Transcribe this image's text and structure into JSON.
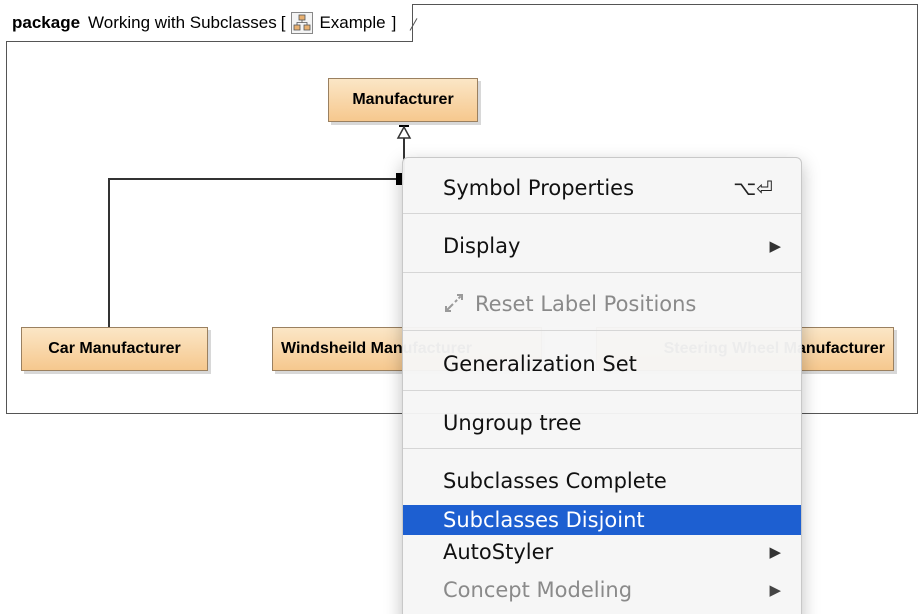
{
  "diagram": {
    "frame_keyword": "package",
    "frame_title": "Working with Subclasses",
    "frame_bracket_open": "[",
    "frame_diagram_name": "Example",
    "frame_bracket_close": "]",
    "classes": {
      "manufacturer": "Manufacturer",
      "car": "Car Manufacturer",
      "windshield": "Windsheild Manufacturer",
      "steering": "Steering Wheel Manufacturer"
    }
  },
  "context_menu": {
    "items": [
      {
        "label": "Symbol Properties",
        "shortcut": "⌥⏎",
        "enabled": true
      },
      {
        "label": "Display",
        "submenu": true,
        "enabled": true
      },
      {
        "label": "Reset Label Positions",
        "enabled": false,
        "icon": "reset-labels-icon"
      },
      {
        "label": "Generalization Set",
        "enabled": true
      },
      {
        "label": "Ungroup tree",
        "enabled": true
      },
      {
        "label": "Subclasses Complete",
        "enabled": true
      },
      {
        "label": "Subclasses Disjoint",
        "enabled": true,
        "selected": true
      },
      {
        "label": "AutoStyler",
        "submenu": true,
        "enabled": true
      },
      {
        "label": "Concept Modeling",
        "submenu": true,
        "enabled": false
      }
    ],
    "submenu_arrow": "▶"
  },
  "colors": {
    "class_fill_top": "#fbe6c6",
    "class_fill_bottom": "#f6c88e",
    "selection": "#1d5fd1",
    "disabled_text": "#8a8a8a"
  }
}
